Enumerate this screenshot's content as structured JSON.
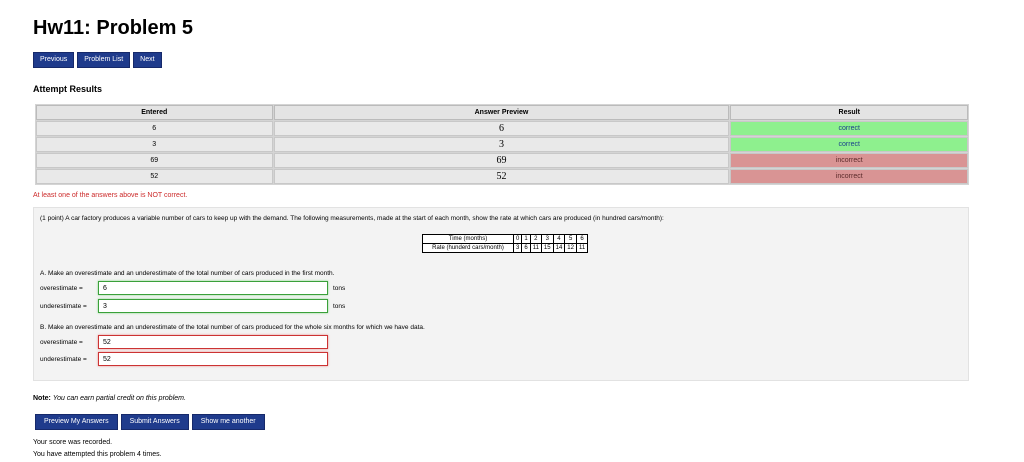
{
  "title": "Hw11: Problem 5",
  "nav": {
    "previous": "Previous",
    "problem_list": "Problem List",
    "next": "Next"
  },
  "results": {
    "heading": "Attempt Results",
    "headers": [
      "Entered",
      "Answer Preview",
      "Result"
    ],
    "rows": [
      {
        "entered": "6",
        "preview": "6",
        "result": "correct"
      },
      {
        "entered": "3",
        "preview": "3",
        "result": "correct"
      },
      {
        "entered": "69",
        "preview": "69",
        "result": "incorrect"
      },
      {
        "entered": "52",
        "preview": "52",
        "result": "incorrect"
      }
    ],
    "warning": "At least one of the answers above is NOT correct."
  },
  "problem": {
    "intro": "(1 point) A car factory produces a variable number of cars to keep up with the demand. The following measurements, made at the start of each month, show the rate at which cars are produced (in hundred cars/month):",
    "table": {
      "time_label": "Time (months)",
      "rate_label": "Rate (hunderd cars/month)",
      "time": [
        "0",
        "1",
        "2",
        "3",
        "4",
        "5",
        "6"
      ],
      "rate": [
        "3",
        "6",
        "11",
        "15",
        "14",
        "12",
        "11"
      ]
    },
    "part_a": "A. Make an overestimate and an underestimate of the total number of cars produced in the first month.",
    "part_b": "B. Make an overestimate and an underestimate of the total number of cars produced for the whole six months for which we have data.",
    "over_label": "overestimate =",
    "under_label": "underestimate =",
    "unit": "tons",
    "a_over": "6",
    "a_under": "3",
    "b_over": "52",
    "b_under": "52"
  },
  "note_label": "Note:",
  "note_text": "You can earn partial credit on this problem.",
  "actions": {
    "preview": "Preview My Answers",
    "submit": "Submit Answers",
    "another": "Show me another"
  },
  "status": {
    "recorded": "Your score was recorded.",
    "attempts": "You have attempted this problem 4 times."
  },
  "colors": {
    "button": "#1f3b8c",
    "correct": "#8ef08e",
    "incorrect": "#d99494",
    "warning": "#cc2a2a"
  }
}
